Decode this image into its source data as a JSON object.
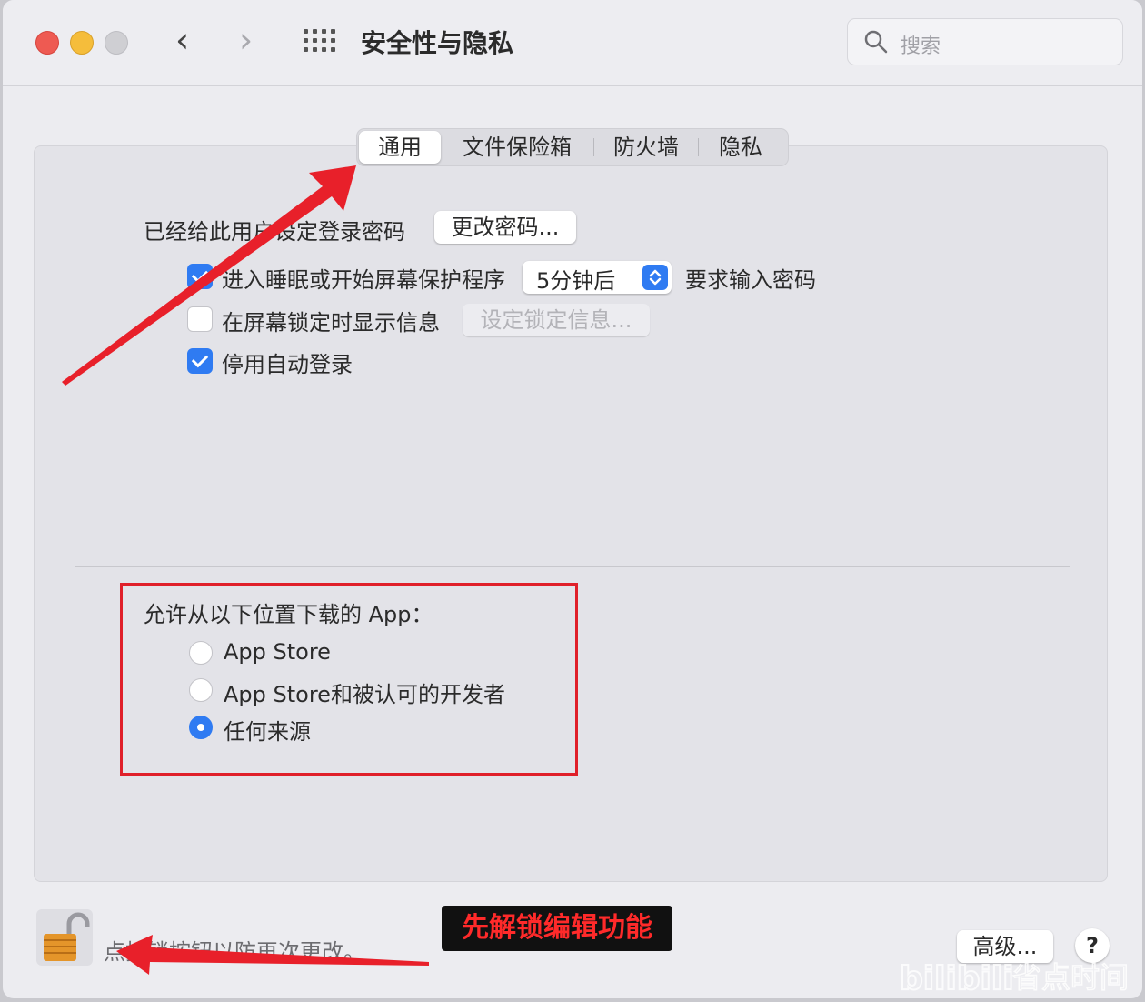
{
  "window": {
    "title": "安全性与隐私",
    "search_placeholder": "搜索"
  },
  "tabs": [
    {
      "label": "通用",
      "active": true
    },
    {
      "label": "文件保险箱",
      "active": false
    },
    {
      "label": "防火墙",
      "active": false
    },
    {
      "label": "隐私",
      "active": false
    }
  ],
  "general": {
    "password_label": "已经给此用户设定登录密码",
    "change_password_button": "更改密码...",
    "sleep_option": {
      "label": "进入睡眠或开始屏幕保护程序",
      "checked": true,
      "select_value": "5分钟后",
      "suffix": "要求输入密码"
    },
    "lock_message_option": {
      "label": "在屏幕锁定时显示信息",
      "checked": false,
      "button": "设定锁定信息..."
    },
    "auto_login_option": {
      "label": "停用自动登录",
      "checked": true
    }
  },
  "downloads": {
    "heading": "允许从以下位置下载的 App：",
    "options": [
      {
        "label": "App Store",
        "selected": false
      },
      {
        "label": "App Store和被认可的开发者",
        "selected": false
      },
      {
        "label": "任何来源",
        "selected": true
      }
    ]
  },
  "footer": {
    "lock_text": "点按锁按钮以防再次更改。",
    "advanced_button": "高级...",
    "help_button": "?"
  },
  "annotation": {
    "note_text": "先解锁编辑功能",
    "arrow_color": "#e8202a",
    "highlight_color": "#e0202a"
  },
  "watermark": {
    "logo_text": "bilibili",
    "text": "省点时间"
  },
  "colors": {
    "accent": "#2f7bf2",
    "window_bg": "#ececf0"
  }
}
